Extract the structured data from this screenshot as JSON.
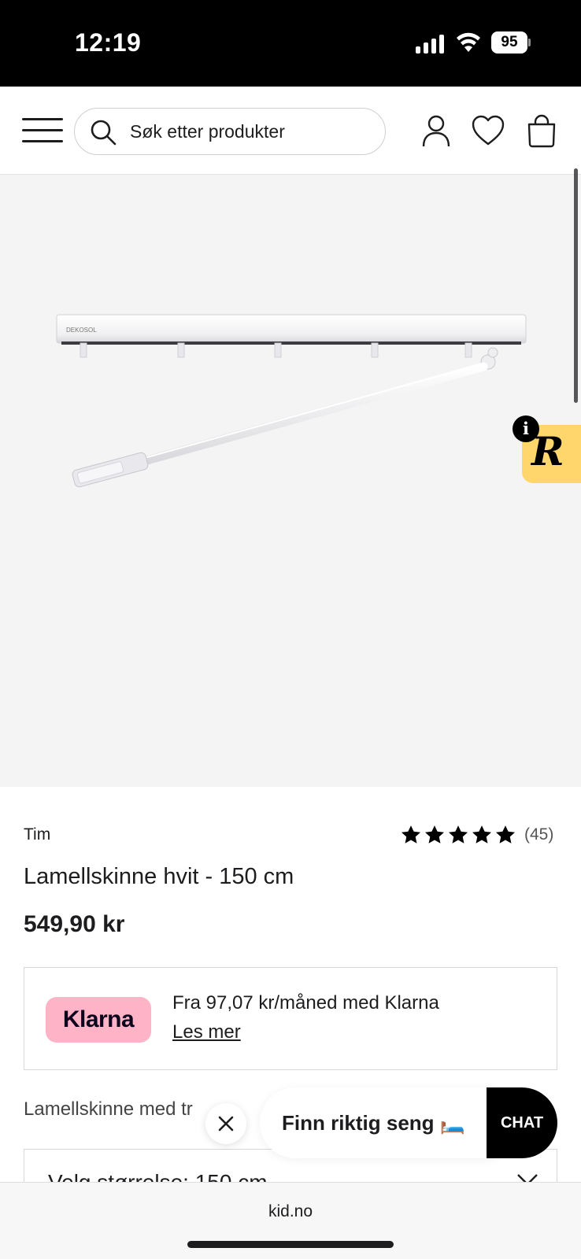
{
  "status_bar": {
    "time": "12:19",
    "battery": "95"
  },
  "header": {
    "search_placeholder": "Søk etter produkter",
    "icons": [
      "menu-icon",
      "search-icon",
      "account-icon",
      "wishlist-heart-icon",
      "shopping-bag-icon"
    ]
  },
  "product": {
    "image_brand_text": "DEKOSOL",
    "brand": "Tim",
    "rating_stars": 5,
    "review_count": "(45)",
    "title": "Lamellskinne hvit - 150 cm",
    "price": "549,90 kr",
    "description_visible": "Lamellskinne med tr"
  },
  "klarna": {
    "logo_text": "Klarna",
    "text": "Fra 97,07 kr/måned med Klarna",
    "link": "Les mer",
    "logo_color": "#ffb3c7"
  },
  "size_select": {
    "label": "Velg størrelse: 150 cm"
  },
  "review_widget": {
    "letter": "R",
    "info": "i",
    "color": "#ffd66b"
  },
  "chat": {
    "prompt": "Finn riktig seng 🛏️",
    "button": "CHAT"
  },
  "browser": {
    "url": "kid.no"
  }
}
